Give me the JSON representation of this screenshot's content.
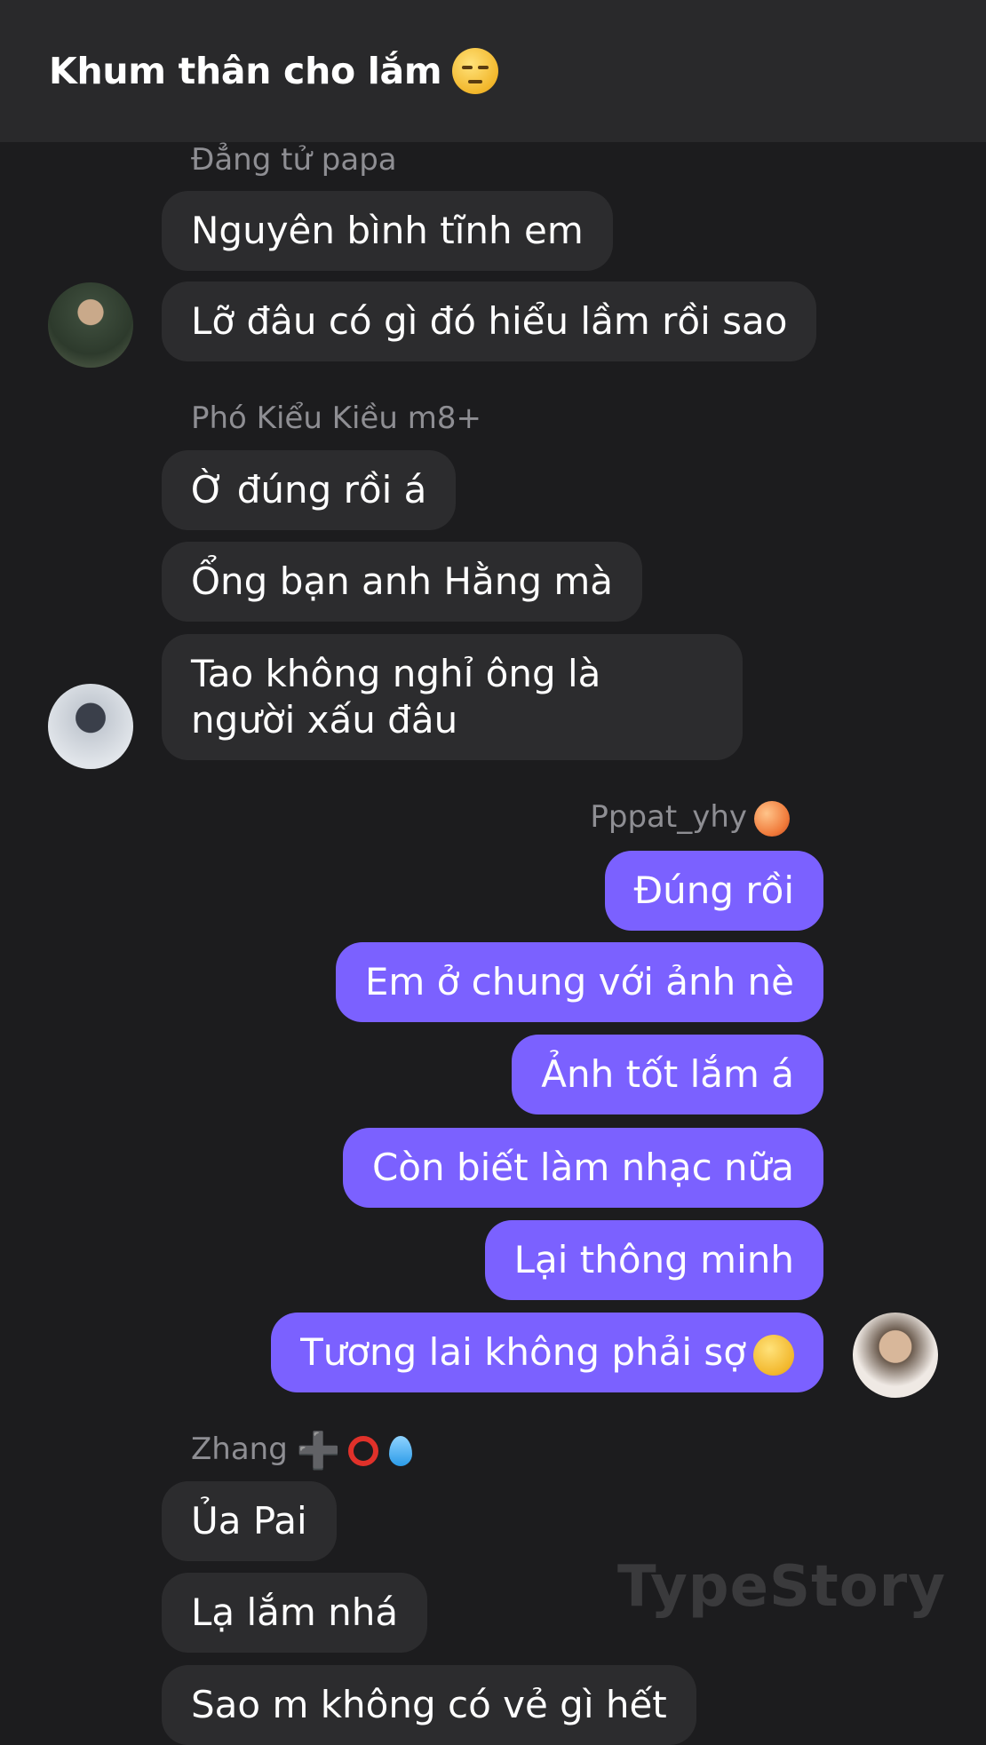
{
  "header": {
    "title": "Khum thân cho lắm",
    "title_emoji": "unamused-face-emoji"
  },
  "groups": [
    {
      "sender": "Đẳng tử papa",
      "avatar": "avatar-photo",
      "messages": [
        "Nguyên bình tĩnh em",
        "Lỡ đâu có gì đó hiểu lầm rồi sao"
      ]
    },
    {
      "sender": "Phó Kiểu Kiều m8+",
      "avatar": "avatar-photo",
      "messages": [
        "Ờ đúng rồi á",
        "Ổng bạn anh Hằng mà",
        "Tao không nghỉ ông là người xấu đâu"
      ]
    },
    {
      "sender": "Pppat_yhy",
      "sender_emoji": "peach-emoji",
      "avatar": "avatar-photo",
      "outgoing": true,
      "messages": [
        "Đúng rồi",
        "Em ở chung với ảnh nè",
        "Ảnh tốt lắm á",
        "Còn biết làm nhạc nữa",
        "Lại thông minh",
        "Tương lai không phải sợ"
      ],
      "last_message_emoji": "hugging-face-emoji"
    },
    {
      "sender": "Zhang",
      "sender_emojis": [
        "plus-icon",
        "red-circle-emoji",
        "droplet-emoji"
      ],
      "messages": [
        "Ủa Pai",
        "Lạ lắm nhá",
        "Sao m không có vẻ gì hết"
      ]
    }
  ],
  "watermark": "TypeStory",
  "colors": {
    "background": "#1c1c1e",
    "header": "#29292b",
    "incoming_bubble": "#2c2c2e",
    "outgoing_bubble": "#7b61ff",
    "sender_name": "#8e8e93"
  }
}
